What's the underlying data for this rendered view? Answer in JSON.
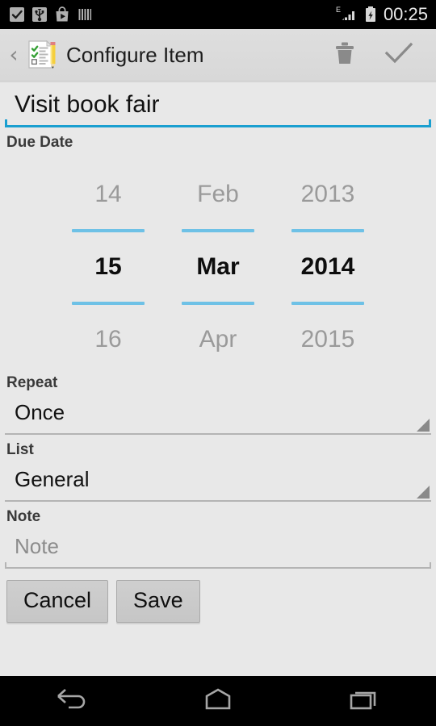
{
  "status_bar": {
    "icons": [
      "tasks-check-icon",
      "usb-icon",
      "play-store-icon",
      "barcode-icon"
    ],
    "network_type": "E",
    "signal_icon": "signal-bars-icon",
    "battery_icon": "battery-charging-icon",
    "clock": "00:25"
  },
  "action_bar": {
    "back_label": "‹",
    "app_icon": "checklist-pencil-icon",
    "title": "Configure Item",
    "delete_icon": "trash-icon",
    "confirm_icon": "check-icon"
  },
  "form": {
    "title_value": "Visit book fair",
    "title_placeholder": "Item",
    "due_date_label": "Due Date",
    "repeat_label": "Repeat",
    "repeat_value": "Once",
    "list_label": "List",
    "list_value": "General",
    "note_label": "Note",
    "note_value": "",
    "note_placeholder": "Note"
  },
  "date_picker": {
    "day": {
      "prev": "14",
      "selected": "15",
      "next": "16"
    },
    "month": {
      "prev": "Feb",
      "selected": "Mar",
      "next": "Apr"
    },
    "year": {
      "prev": "2013",
      "selected": "2014",
      "next": "2015"
    }
  },
  "buttons": {
    "cancel": "Cancel",
    "save": "Save"
  },
  "nav_bar": {
    "back": "back-icon",
    "home": "home-icon",
    "recents": "recents-icon"
  },
  "colors": {
    "accent_focus": "#1a9fd0",
    "accent_picker": "#6ec1e6",
    "background": "#e8e8e8",
    "action_bar": "#dedede",
    "text_primary": "#111111",
    "text_hint": "#8c8c8c"
  }
}
